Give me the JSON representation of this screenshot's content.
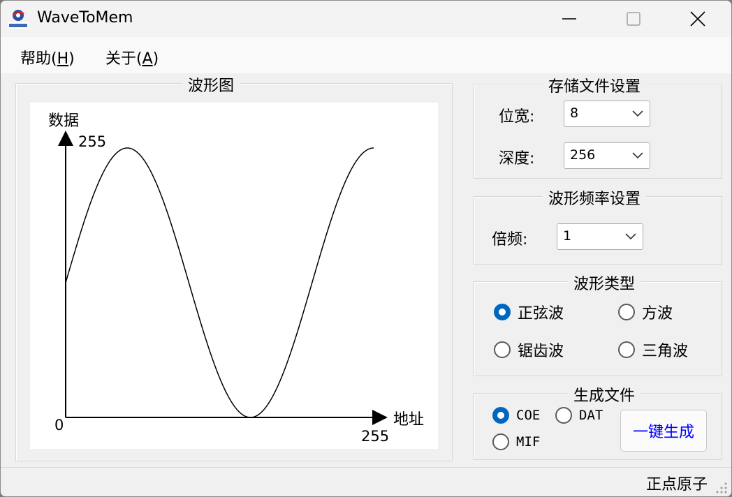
{
  "window": {
    "title": "WaveToMem",
    "app_icon": "zhengdian-atom-logo-icon",
    "app_icon_text": "正点原子"
  },
  "menu": [
    {
      "label": "帮助(",
      "key": "H",
      "suffix": ")"
    },
    {
      "label": "关于(",
      "key": "A",
      "suffix": ")"
    }
  ],
  "waveform": {
    "group_title": "波形图",
    "y_label": "数据",
    "y_max_label": "255",
    "x_label": "地址",
    "x_max_label": "255",
    "origin_label": "0",
    "wave_type": "sine"
  },
  "storage": {
    "group_title": "存储文件设置",
    "width_label": "位宽:",
    "width_value": "8",
    "depth_label": "深度:",
    "depth_value": "256"
  },
  "frequency": {
    "group_title": "波形频率设置",
    "multiplier_label": "倍频:",
    "multiplier_value": "1"
  },
  "wave_types": {
    "group_title": "波形类型",
    "options": [
      {
        "label": "正弦波",
        "selected": true
      },
      {
        "label": "方波",
        "selected": false
      },
      {
        "label": "锯齿波",
        "selected": false
      },
      {
        "label": "三角波",
        "selected": false
      }
    ]
  },
  "generate": {
    "group_title": "生成文件",
    "formats": [
      {
        "label": "COE",
        "selected": true
      },
      {
        "label": "DAT",
        "selected": false
      },
      {
        "label": "MIF",
        "selected": false
      }
    ],
    "button_label": "一键生成"
  },
  "status": {
    "text": "正点原子"
  },
  "colors": {
    "accent": "#0067c0",
    "button_text": "#0000ff"
  }
}
